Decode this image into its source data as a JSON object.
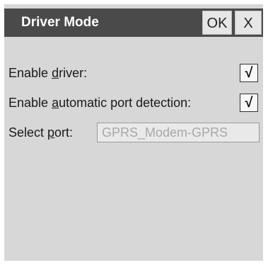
{
  "dialog": {
    "title": "Driver Mode",
    "ok_label": "OK",
    "close_label": "X"
  },
  "form": {
    "enable_driver": {
      "label_pre": "Enable ",
      "label_accel": "d",
      "label_post": "river:",
      "checked": true,
      "mark": "√"
    },
    "auto_port": {
      "label_pre": "Enable ",
      "label_accel": "a",
      "label_post": "utomatic port detection:",
      "checked": true,
      "mark": "√"
    },
    "select_port": {
      "label_pre": "Select ",
      "label_accel": "p",
      "label_post": "ort:",
      "value": "GPRS_Modem-GPRS"
    }
  }
}
